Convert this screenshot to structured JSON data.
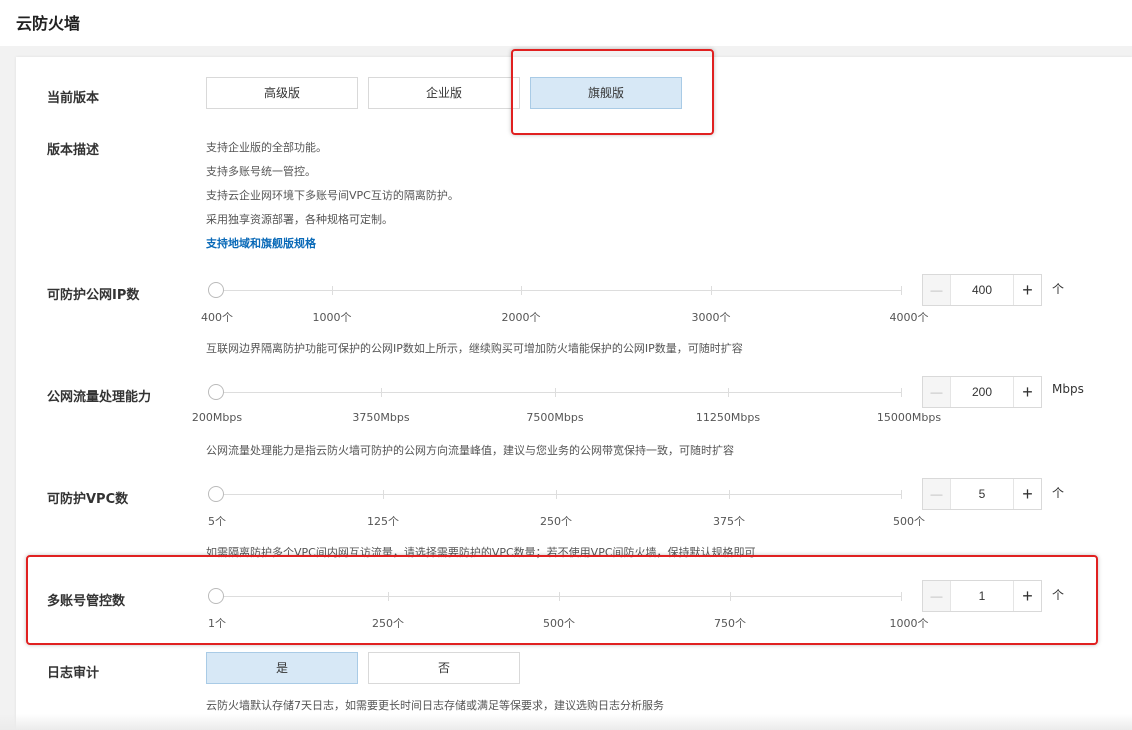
{
  "page": {
    "title": "云防火墙"
  },
  "edition": {
    "label": "当前版本",
    "options": [
      "高级版",
      "企业版",
      "旗舰版"
    ],
    "selected": "旗舰版"
  },
  "description": {
    "label": "版本描述",
    "lines": [
      "支持企业版的全部功能。",
      "支持多账号统一管控。",
      "支持云企业网环境下多账号间VPC互访的隔离防护。",
      "采用独享资源部署，各种规格可定制。"
    ],
    "link": "支持地域和旗舰版规格"
  },
  "public_ip": {
    "label": "可防护公网IP数",
    "ticks": [
      "400个",
      "1000个",
      "2000个",
      "3000个",
      "4000个"
    ],
    "value": "400",
    "unit": "个",
    "level": 0,
    "note": "互联网边界隔离防护功能可保护的公网IP数如上所示，继续购买可增加防火墙能保护的公网IP数量，可随时扩容"
  },
  "bandwidth": {
    "label": "公网流量处理能力",
    "ticks": [
      "200Mbps",
      "3750Mbps",
      "7500Mbps",
      "11250Mbps",
      "15000Mbps"
    ],
    "value": "200",
    "unit": "Mbps",
    "level": 0,
    "note": "公网流量处理能力是指云防火墙可防护的公网方向流量峰值，建议与您业务的公网带宽保持一致，可随时扩容"
  },
  "vpc": {
    "label": "可防护VPC数",
    "ticks": [
      "5个",
      "125个",
      "250个",
      "375个",
      "500个"
    ],
    "value": "5",
    "unit": "个",
    "level": 0,
    "note": "如需隔离防护多个VPC间内网互访流量，请选择需要防护的VPC数量；若不使用VPC间防火墙，保持默认规格即可"
  },
  "accounts": {
    "label": "多账号管控数",
    "ticks": [
      "1个",
      "250个",
      "500个",
      "750个",
      "1000个"
    ],
    "value": "1",
    "unit": "个",
    "level": 0
  },
  "log_audit": {
    "label": "日志审计",
    "options": [
      "是",
      "否"
    ],
    "selected": "是",
    "note": "云防火墙默认存储7天日志，如需要更长时间日志存储或满足等保要求，建议选购日志分析服务"
  },
  "icons": {
    "minus": "minus-icon",
    "plus": "plus-icon"
  },
  "colors": {
    "active_option": "#d7e8f6",
    "link": "#0a6ab8",
    "highlight_box": "#e02020"
  }
}
